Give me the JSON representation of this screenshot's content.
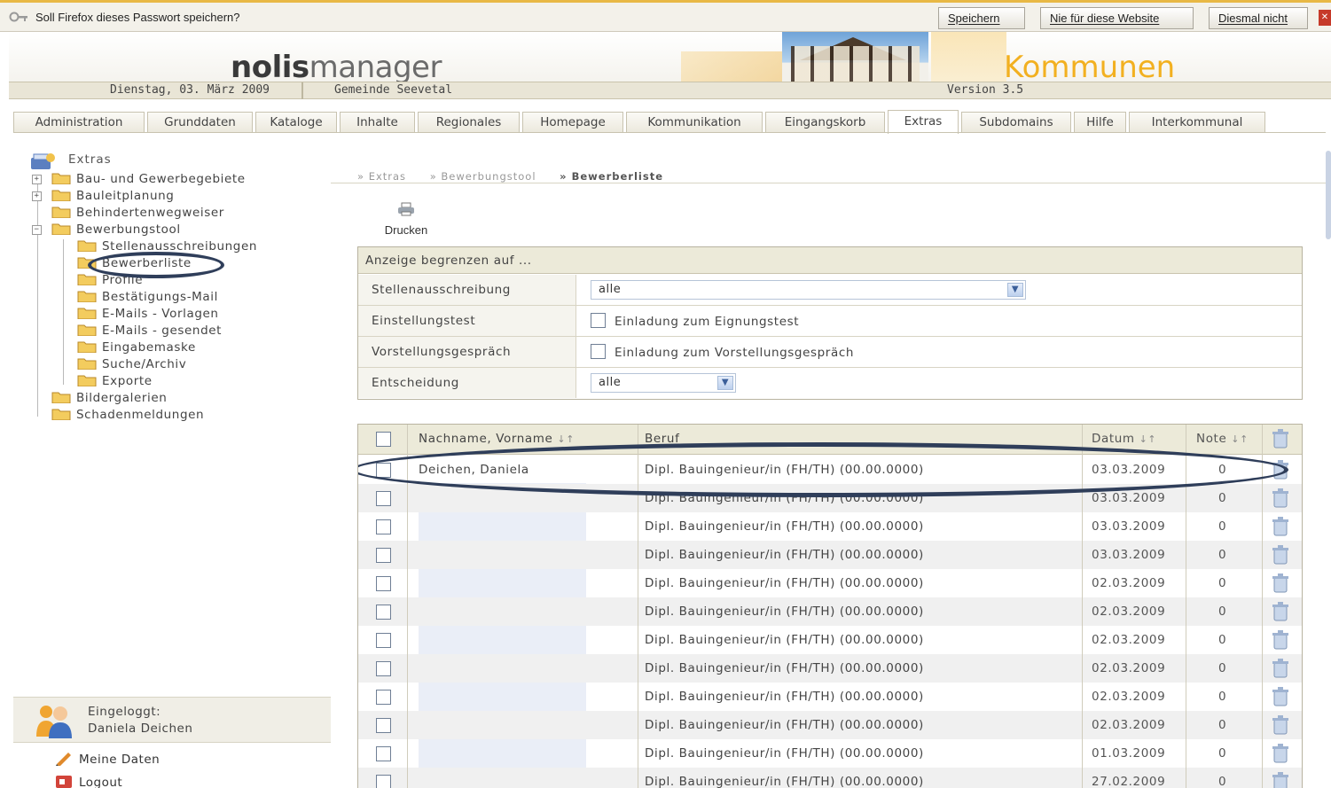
{
  "password_bar": {
    "message": "Soll Firefox dieses Passwort speichern?",
    "save_label": "Speichern",
    "never_label": "Nie für diese Website",
    "not_now_label": "Diesmal nicht"
  },
  "header": {
    "logo_bold": "nolis",
    "logo_light": "manager",
    "product": "Kommunen",
    "date": "Dienstag, 03. März 2009",
    "municipality": "Gemeinde Seevetal",
    "version": "Version 3.5"
  },
  "tabs": [
    {
      "label": "Administration"
    },
    {
      "label": "Grunddaten"
    },
    {
      "label": "Kataloge"
    },
    {
      "label": "Inhalte"
    },
    {
      "label": "Regionales"
    },
    {
      "label": "Homepage"
    },
    {
      "label": "Kommunikation"
    },
    {
      "label": "Eingangskorb"
    },
    {
      "label": "Extras"
    },
    {
      "label": "Subdomains"
    },
    {
      "label": "Hilfe"
    },
    {
      "label": "Interkommunal"
    }
  ],
  "active_tab": "Extras",
  "sidebar": {
    "root": "Extras",
    "tree": [
      {
        "label": "Bau- und Gewerbegebiete"
      },
      {
        "label": "Bauleitplanung"
      },
      {
        "label": "Behindertenwegweiser"
      },
      {
        "label": "Bewerbungstool"
      },
      {
        "label": "Stellenausschreibungen"
      },
      {
        "label": "Bewerberliste"
      },
      {
        "label": "Profile"
      },
      {
        "label": "Bestätigungs-Mail"
      },
      {
        "label": "E-Mails - Vorlagen"
      },
      {
        "label": "E-Mails - gesendet"
      },
      {
        "label": "Eingabemaske"
      },
      {
        "label": "Suche/Archiv"
      },
      {
        "label": "Exporte"
      },
      {
        "label": "Bildergalerien"
      },
      {
        "label": "Schadenmeldungen"
      }
    ],
    "login_label": "Eingeloggt:",
    "user": "Daniela Deichen",
    "my_data": "Meine Daten",
    "logout": "Logout"
  },
  "breadcrumb": [
    "» Extras",
    "» Bewerbungstool",
    "» Bewerberliste"
  ],
  "print_label": "Drucken",
  "filter": {
    "title": "Anzeige begrenzen auf ...",
    "rows": [
      {
        "label": "Stellenausschreibung",
        "value": "alle"
      },
      {
        "label": "Einstellungstest",
        "value": "Einladung zum Eignungstest"
      },
      {
        "label": "Vorstellungsgespräch",
        "value": "Einladung zum Vorstellungsgespräch"
      },
      {
        "label": "Entscheidung",
        "value": "alle"
      }
    ]
  },
  "table": {
    "headers": {
      "name": "Nachname, Vorname",
      "beruf": "Beruf",
      "datum": "Datum",
      "note": "Note",
      "sort_glyph": "↓↑"
    },
    "rows": [
      {
        "name": "Deichen, Daniela",
        "beruf": "Dipl. Bauingenieur/in (FH/TH) (00.00.0000)",
        "datum": "03.03.2009",
        "note": "0"
      },
      {
        "name": "",
        "beruf": "Dipl. Bauingenieur/in (FH/TH) (00.00.0000)",
        "datum": "03.03.2009",
        "note": "0"
      },
      {
        "name": "",
        "beruf": "Dipl. Bauingenieur/in (FH/TH) (00.00.0000)",
        "datum": "03.03.2009",
        "note": "0"
      },
      {
        "name": "",
        "beruf": "Dipl. Bauingenieur/in (FH/TH) (00.00.0000)",
        "datum": "03.03.2009",
        "note": "0"
      },
      {
        "name": "",
        "beruf": "Dipl. Bauingenieur/in (FH/TH) (00.00.0000)",
        "datum": "02.03.2009",
        "note": "0"
      },
      {
        "name": "",
        "beruf": "Dipl. Bauingenieur/in (FH/TH) (00.00.0000)",
        "datum": "02.03.2009",
        "note": "0"
      },
      {
        "name": "",
        "beruf": "Dipl. Bauingenieur/in (FH/TH) (00.00.0000)",
        "datum": "02.03.2009",
        "note": "0"
      },
      {
        "name": "",
        "beruf": "Dipl. Bauingenieur/in (FH/TH) (00.00.0000)",
        "datum": "02.03.2009",
        "note": "0"
      },
      {
        "name": "",
        "beruf": "Dipl. Bauingenieur/in (FH/TH) (00.00.0000)",
        "datum": "02.03.2009",
        "note": "0"
      },
      {
        "name": "",
        "beruf": "Dipl. Bauingenieur/in (FH/TH) (00.00.0000)",
        "datum": "02.03.2009",
        "note": "0"
      },
      {
        "name": "",
        "beruf": "Dipl. Bauingenieur/in (FH/TH) (00.00.0000)",
        "datum": "01.03.2009",
        "note": "0"
      },
      {
        "name": "",
        "beruf": "Dipl. Bauingenieur/in (FH/TH) (00.00.0000)",
        "datum": "27.02.2009",
        "note": "0"
      }
    ]
  },
  "colors": {
    "accent_orange": "#f2b020",
    "highlight_ring": "#2f3e5a",
    "header_strip": "#e9e5d6"
  }
}
